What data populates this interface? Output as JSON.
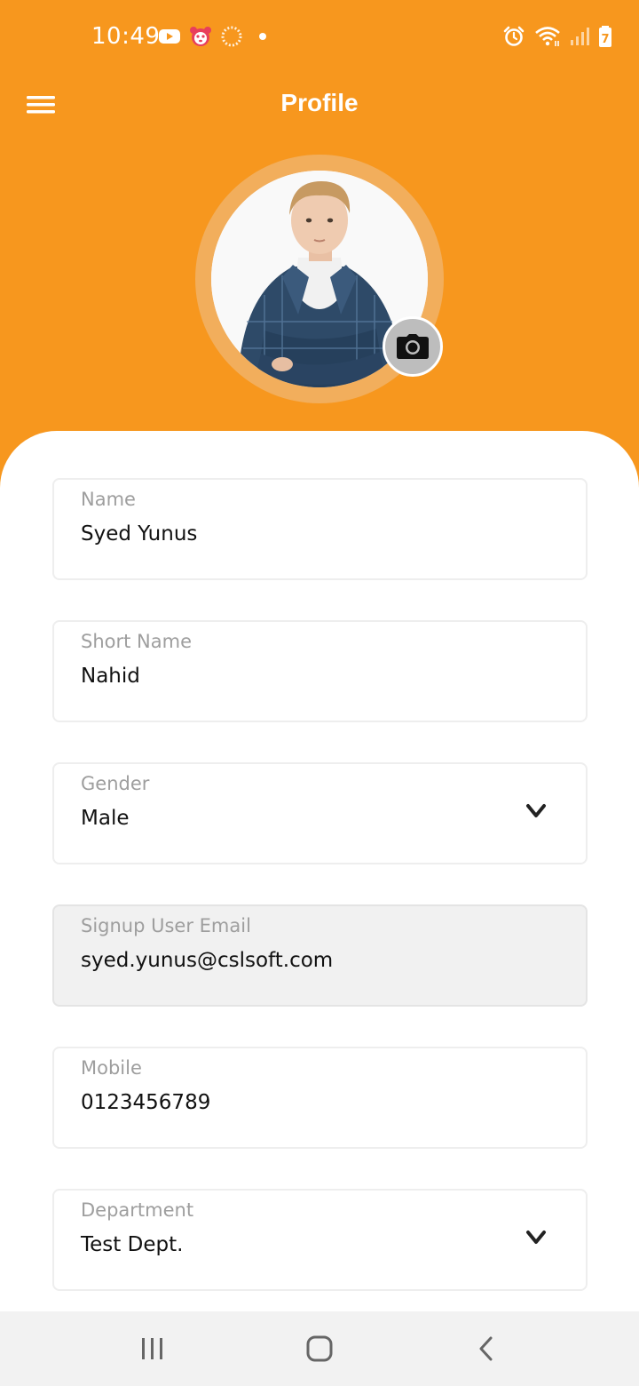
{
  "status_bar": {
    "time": "10:49",
    "icons": [
      "youtube-icon",
      "panda-icon",
      "loading-icon",
      "dot-icon",
      "alarm-icon",
      "wifi-icon",
      "signal-icon",
      "battery-icon"
    ],
    "battery_level": "7"
  },
  "app_bar": {
    "title": "Profile",
    "menu_icon": "hamburger-menu-icon"
  },
  "profile": {
    "avatar_icon": "user-avatar",
    "camera_icon": "camera-icon"
  },
  "form": {
    "name": {
      "label": "Name",
      "value": "Syed Yunus"
    },
    "short_name": {
      "label": "Short Name",
      "value": "Nahid"
    },
    "gender": {
      "label": "Gender",
      "value": "Male"
    },
    "email": {
      "label": "Signup User Email",
      "value": "syed.yunus@cslsoft.com"
    },
    "mobile": {
      "label": "Mobile",
      "value": "0123456789"
    },
    "department": {
      "label": "Department",
      "value": "Test Dept."
    }
  },
  "nav_bar": {
    "icons": [
      "recent-apps-icon",
      "home-icon",
      "back-icon"
    ]
  },
  "colors": {
    "primary": "#f7971e",
    "avatar_ring": "#f2ae5c",
    "card_bg": "#ffffff",
    "disabled_field": "#f1f1f1",
    "label_text": "#9e9e9e",
    "value_text": "#111111"
  }
}
